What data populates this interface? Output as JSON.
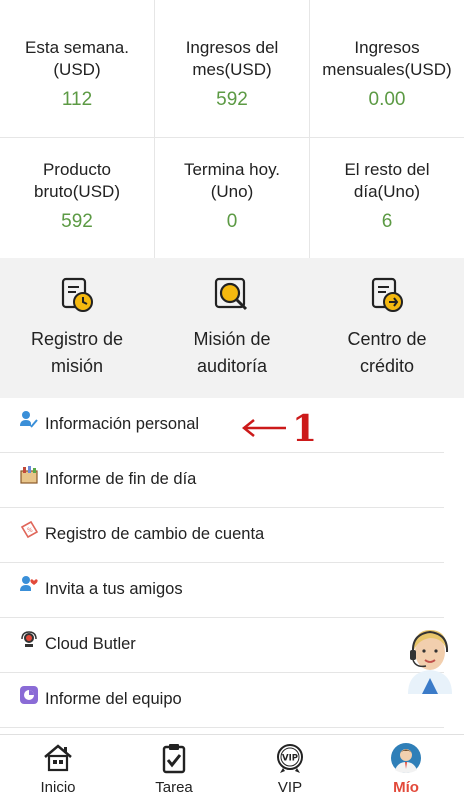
{
  "stats": [
    {
      "label": "Esta semana.(USD)",
      "value": "112"
    },
    {
      "label": "Ingresos del mes(USD)",
      "value": "592"
    },
    {
      "label": "Ingresos mensuales(USD)",
      "value": "0.00"
    },
    {
      "label": "Producto bruto(USD)",
      "value": "592"
    },
    {
      "label": "Termina hoy.(Uno)",
      "value": "0"
    },
    {
      "label": "El resto del día(Uno)",
      "value": "6"
    }
  ],
  "actions": [
    {
      "label": "Registro de misión",
      "icon": "document-clock-icon"
    },
    {
      "label": "Misión de auditoría",
      "icon": "magnifier-document-icon"
    },
    {
      "label": "Centro de crédito",
      "icon": "document-arrow-icon"
    }
  ],
  "menu": [
    {
      "label": "Información personal",
      "icon": "user-edit-icon"
    },
    {
      "label": "Informe de fin de día",
      "icon": "calendar-report-icon"
    },
    {
      "label": "Registro de cambio de cuenta",
      "icon": "coupon-icon"
    },
    {
      "label": "Invita a tus amigos",
      "icon": "user-heart-icon"
    },
    {
      "label": "Cloud Butler",
      "icon": "headset-icon"
    },
    {
      "label": "Informe del equipo",
      "icon": "team-report-icon"
    }
  ],
  "annotation": {
    "number": "1"
  },
  "tabs": [
    {
      "label": "Inicio",
      "icon": "home-icon",
      "active": false
    },
    {
      "label": "Tarea",
      "icon": "clipboard-check-icon",
      "active": false
    },
    {
      "label": "VIP",
      "icon": "vip-badge-icon",
      "active": false
    },
    {
      "label": "Mío",
      "icon": "profile-avatar-icon",
      "active": true
    }
  ],
  "colors": {
    "value_green": "#5c9a44",
    "active_tab": "#e2493a",
    "annotation_red": "#cc1a1a",
    "icon_yellow": "#f5b90f"
  }
}
